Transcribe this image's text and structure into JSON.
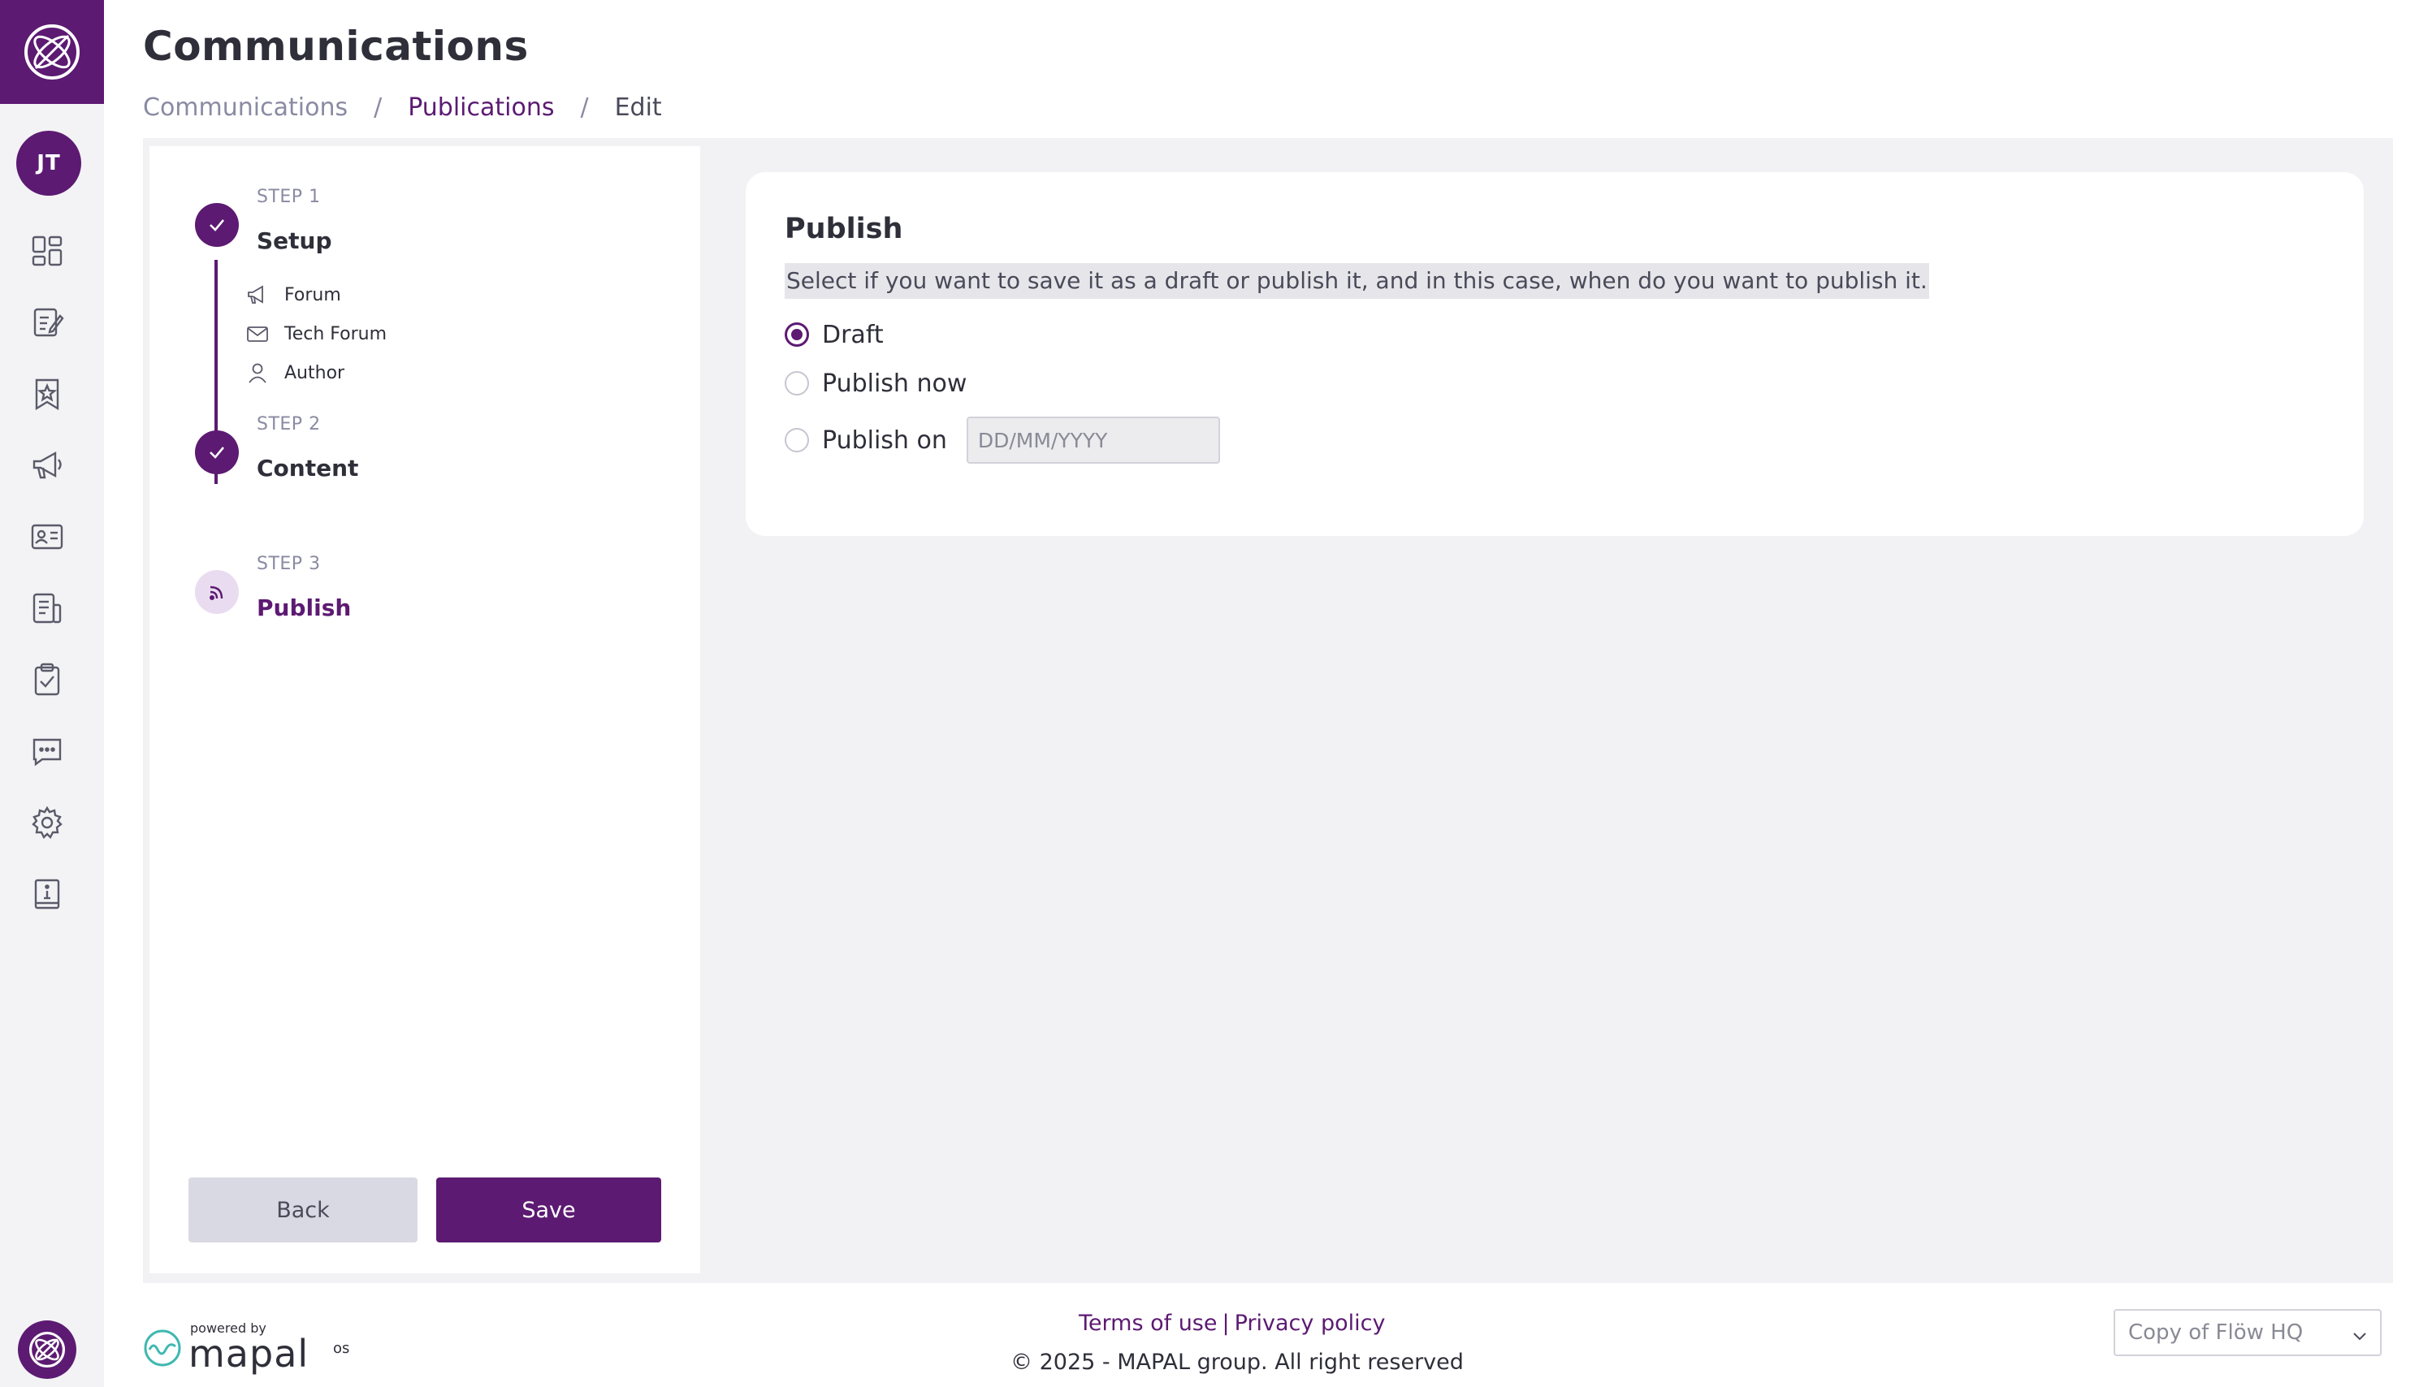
{
  "app": {
    "logo_icon": "mapal-globe-icon",
    "accent_color": "#5c1a72"
  },
  "user": {
    "initials": "JT"
  },
  "sidebar": {
    "items": [
      {
        "icon": "dashboard-icon"
      },
      {
        "icon": "edit-document-icon"
      },
      {
        "icon": "badge-star-icon"
      },
      {
        "icon": "megaphone-icon"
      },
      {
        "icon": "id-card-icon"
      },
      {
        "icon": "report-icon"
      },
      {
        "icon": "clipboard-check-icon"
      },
      {
        "icon": "chat-icon"
      },
      {
        "icon": "gear-icon"
      },
      {
        "icon": "info-book-icon"
      }
    ]
  },
  "header": {
    "title": "Communications",
    "breadcrumb": [
      "Communications",
      "Publications",
      "Edit"
    ],
    "separator": "/"
  },
  "stepper": {
    "steps": [
      {
        "label": "STEP 1",
        "title": "Setup",
        "status": "done",
        "details": [
          {
            "icon": "megaphone-icon",
            "text": "Forum"
          },
          {
            "icon": "mail-icon",
            "text": "Tech Forum"
          },
          {
            "icon": "user-icon",
            "text": "Author"
          }
        ]
      },
      {
        "label": "STEP 2",
        "title": "Content",
        "status": "done"
      },
      {
        "label": "STEP 3",
        "title": "Publish",
        "status": "current"
      }
    ],
    "back_label": "Back",
    "save_label": "Save"
  },
  "publish": {
    "title": "Publish",
    "description": "Select if you want to save it as a draft or publish it, and in this case, when do you want to publish it.",
    "options": [
      {
        "label": "Draft",
        "checked": true
      },
      {
        "label": "Publish now",
        "checked": false
      },
      {
        "label": "Publish on",
        "checked": false
      }
    ],
    "date_placeholder": "DD/MM/YYYY"
  },
  "footer": {
    "powered_by": "powered by",
    "brand": "mapal",
    "brand_suffix": "os",
    "terms": "Terms of use",
    "link_separator": "|",
    "privacy": "Privacy policy",
    "copyright": "© 2025 - MAPAL group. All right reserved",
    "site_selector": "Copy of Flöw HQ"
  }
}
